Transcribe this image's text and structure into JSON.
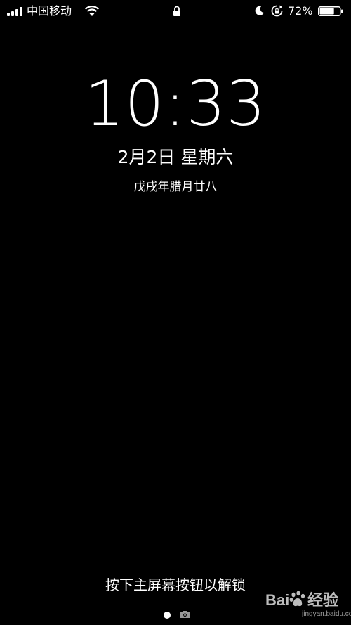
{
  "status_bar": {
    "carrier": "中国移动",
    "battery_percent": "72%",
    "battery_level": 0.72,
    "icons": {
      "signal": "signal-bars-icon",
      "wifi": "wifi-icon",
      "lock": "lock-icon",
      "do_not_disturb": "moon-icon",
      "rotation_lock": "rotation-lock-icon",
      "battery": "battery-icon"
    }
  },
  "lock_screen": {
    "time": "10:33",
    "date": "2月2日 星期六",
    "lunar_date": "戊戌年腊月廿八",
    "unlock_hint": "按下主屏幕按钮以解锁",
    "page_indicator": "page-dot-icon",
    "camera_icon": "camera-icon"
  },
  "watermark": {
    "brand_left": "Bai",
    "brand_right": "经验",
    "url": "jingyan.baidu.com",
    "icon": "baidu-paw-icon"
  }
}
